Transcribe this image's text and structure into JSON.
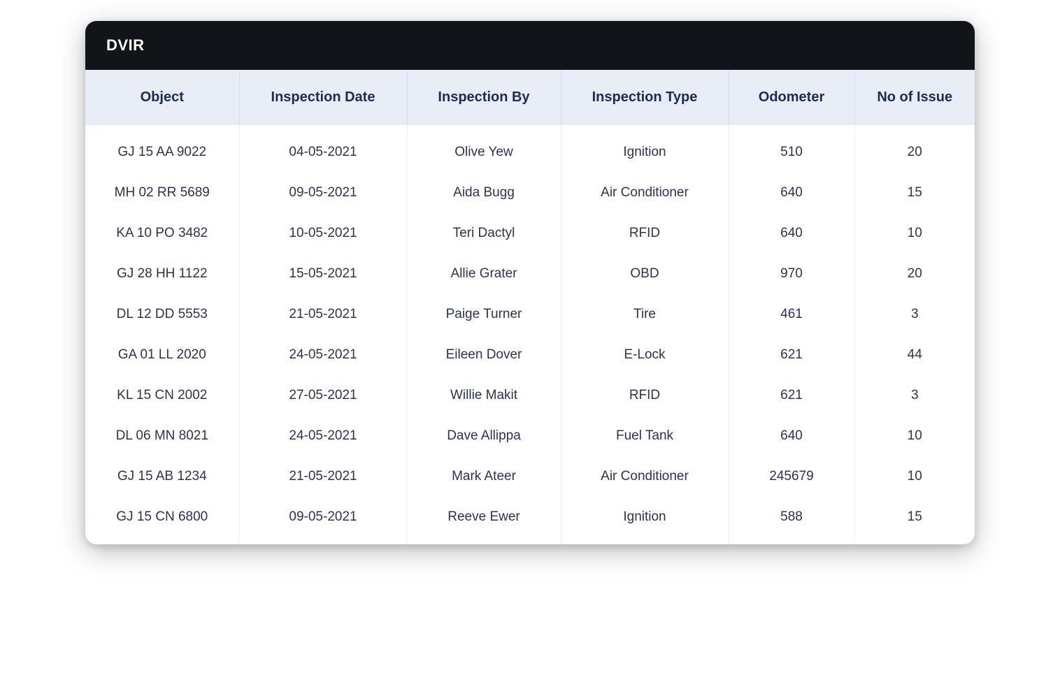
{
  "header": {
    "title": "DVIR"
  },
  "table": {
    "columns": [
      "Object",
      "Inspection Date",
      "Inspection By",
      "Inspection Type",
      "Odometer",
      "No of Issue"
    ],
    "rows": [
      {
        "object": "GJ 15 AA 9022",
        "date": "04-05-2021",
        "by": "Olive Yew",
        "type": "Ignition",
        "odometer": "510",
        "issues": "20"
      },
      {
        "object": "MH 02 RR 5689",
        "date": "09-05-2021",
        "by": "Aida Bugg",
        "type": "Air Conditioner",
        "odometer": "640",
        "issues": "15"
      },
      {
        "object": "KA 10 PO 3482",
        "date": "10-05-2021",
        "by": "Teri Dactyl",
        "type": "RFID",
        "odometer": "640",
        "issues": "10"
      },
      {
        "object": "GJ 28 HH 1122",
        "date": "15-05-2021",
        "by": "Allie Grater",
        "type": "OBD",
        "odometer": "970",
        "issues": "20"
      },
      {
        "object": "DL 12 DD 5553",
        "date": "21-05-2021",
        "by": "Paige Turner",
        "type": "Tire",
        "odometer": "461",
        "issues": "3"
      },
      {
        "object": "GA 01 LL 2020",
        "date": "24-05-2021",
        "by": "Eileen Dover",
        "type": "E-Lock",
        "odometer": "621",
        "issues": "44"
      },
      {
        "object": "KL 15 CN 2002",
        "date": "27-05-2021",
        "by": "Willie Makit",
        "type": "RFID",
        "odometer": "621",
        "issues": "3"
      },
      {
        "object": "DL 06 MN 8021",
        "date": "24-05-2021",
        "by": "Dave Allippa",
        "type": "Fuel Tank",
        "odometer": "640",
        "issues": "10"
      },
      {
        "object": "GJ 15 AB 1234",
        "date": "21-05-2021",
        "by": "Mark Ateer",
        "type": "Air Conditioner",
        "odometer": "245679",
        "issues": "10"
      },
      {
        "object": "GJ 15 CN 6800",
        "date": "09-05-2021",
        "by": "Reeve Ewer",
        "type": "Ignition",
        "odometer": "588",
        "issues": "15"
      }
    ]
  }
}
